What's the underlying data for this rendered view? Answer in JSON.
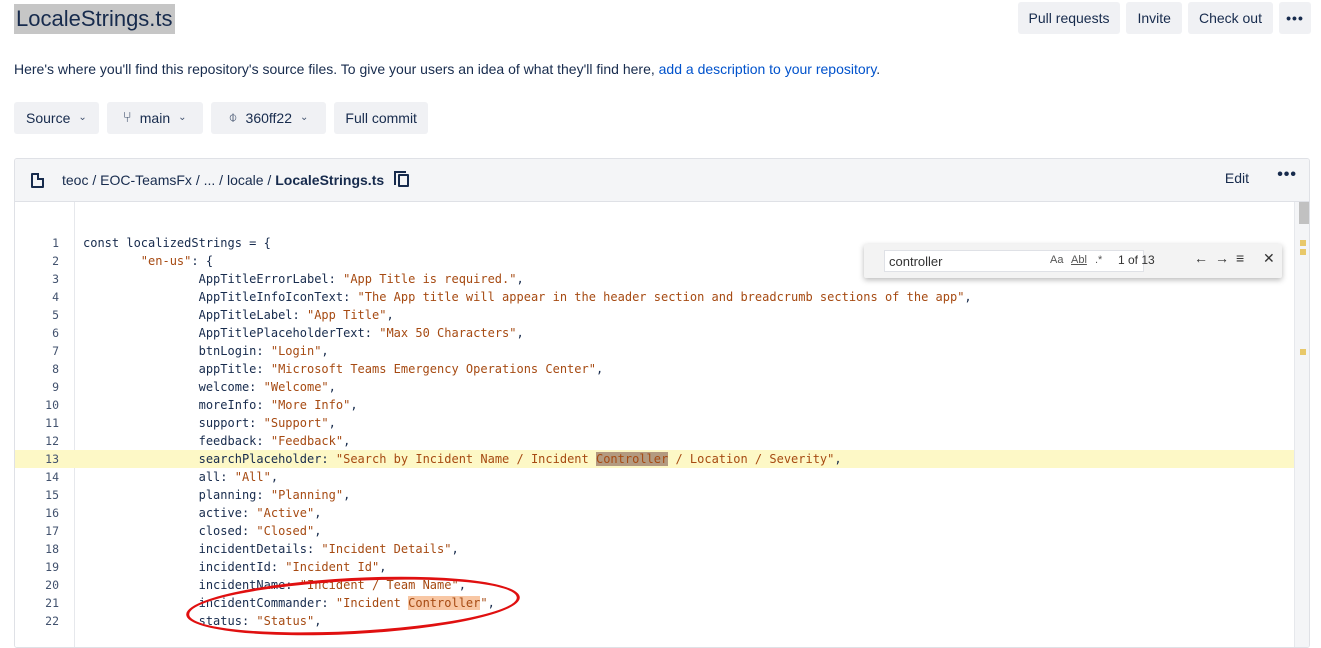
{
  "header": {
    "title": "LocaleStrings.ts",
    "actions": [
      "Pull requests",
      "Invite",
      "Check out"
    ],
    "more_glyph": "•••"
  },
  "description": {
    "text": "Here's where you'll find this repository's source files. To give your users an idea of what they'll find here, ",
    "link": "add a description to your repository",
    "suffix": "."
  },
  "filters": {
    "source": "Source",
    "branch": "main",
    "commit": "360ff22",
    "full_commit": "Full commit",
    "chevron": "⌄",
    "branch_icon": "⑂",
    "commit_icon": "⌽"
  },
  "file": {
    "breadcrumb": [
      "teoc",
      "EOC-TeamsFx",
      "...",
      "locale",
      "LocaleStrings.ts"
    ],
    "separator": " / ",
    "edit": "Edit",
    "more_glyph": "•••"
  },
  "find": {
    "query": "controller",
    "opt_case": "Aa",
    "opt_word": "Abl",
    "opt_regex": ".*",
    "count": "1 of 13",
    "prev": "←",
    "next": "→",
    "sel": "≡",
    "close": "✕"
  },
  "code": {
    "lines": [
      {
        "n": "1",
        "pre": "const localizedStrings = {",
        "s1": "",
        "m": "",
        "s2": "",
        "post": ""
      },
      {
        "n": "2",
        "pre": "        ",
        "s1": "\"en-us\"",
        "m": "",
        "s2": "",
        "post": ": {"
      },
      {
        "n": "3",
        "pre": "                AppTitleErrorLabel: ",
        "s1": "\"App Title is required.\"",
        "m": "",
        "s2": "",
        "post": ","
      },
      {
        "n": "4",
        "pre": "                AppTitleInfoIconText: ",
        "s1": "\"The App title will appear in the header section and breadcrumb sections of the app\"",
        "m": "",
        "s2": "",
        "post": ","
      },
      {
        "n": "5",
        "pre": "                AppTitleLabel: ",
        "s1": "\"App Title\"",
        "m": "",
        "s2": "",
        "post": ","
      },
      {
        "n": "6",
        "pre": "                AppTitlePlaceholderText: ",
        "s1": "\"Max 50 Characters\"",
        "m": "",
        "s2": "",
        "post": ","
      },
      {
        "n": "7",
        "pre": "                btnLogin: ",
        "s1": "\"Login\"",
        "m": "",
        "s2": "",
        "post": ","
      },
      {
        "n": "8",
        "pre": "                appTitle: ",
        "s1": "\"Microsoft Teams Emergency Operations Center\"",
        "m": "",
        "s2": "",
        "post": ","
      },
      {
        "n": "9",
        "pre": "                welcome: ",
        "s1": "\"Welcome\"",
        "m": "",
        "s2": "",
        "post": ","
      },
      {
        "n": "10",
        "pre": "                moreInfo: ",
        "s1": "\"More Info\"",
        "m": "",
        "s2": "",
        "post": ","
      },
      {
        "n": "11",
        "pre": "                support: ",
        "s1": "\"Support\"",
        "m": "",
        "s2": "",
        "post": ","
      },
      {
        "n": "12",
        "pre": "                feedback: ",
        "s1": "\"Feedback\"",
        "m": "",
        "s2": "",
        "post": ","
      },
      {
        "n": "13",
        "pre": "                searchPlaceholder: ",
        "s1": "\"Search by Incident Name / Incident ",
        "m": "Controller",
        "s2": " / Location / Severity\"",
        "post": ",",
        "hl": true,
        "mclass": "match"
      },
      {
        "n": "14",
        "pre": "                all: ",
        "s1": "\"All\"",
        "m": "",
        "s2": "",
        "post": ","
      },
      {
        "n": "15",
        "pre": "                planning: ",
        "s1": "\"Planning\"",
        "m": "",
        "s2": "",
        "post": ","
      },
      {
        "n": "16",
        "pre": "                active: ",
        "s1": "\"Active\"",
        "m": "",
        "s2": "",
        "post": ","
      },
      {
        "n": "17",
        "pre": "                closed: ",
        "s1": "\"Closed\"",
        "m": "",
        "s2": "",
        "post": ","
      },
      {
        "n": "18",
        "pre": "                incidentDetails: ",
        "s1": "\"Incident Details\"",
        "m": "",
        "s2": "",
        "post": ","
      },
      {
        "n": "19",
        "pre": "                incidentId: ",
        "s1": "\"Incident Id\"",
        "m": "",
        "s2": "",
        "post": ","
      },
      {
        "n": "20",
        "pre": "                incidentName: ",
        "s1": "\"Incident / Team Name\"",
        "m": "",
        "s2": "",
        "post": ","
      },
      {
        "n": "21",
        "pre": "                incidentCommander: ",
        "s1": "\"Incident ",
        "m": "Controller",
        "s2": "\"",
        "post": ",",
        "mclass": "match2"
      },
      {
        "n": "22",
        "pre": "                status: ",
        "s1": "\"Status\"",
        "m": "",
        "s2": "",
        "post": ","
      }
    ]
  },
  "colors": {
    "string": "#a64a12",
    "current_match": "#b39a80",
    "other_match": "#f8c7a4",
    "line_highlight": "#fdf8c6",
    "annotation": "#e01010",
    "link": "#0052cc"
  }
}
